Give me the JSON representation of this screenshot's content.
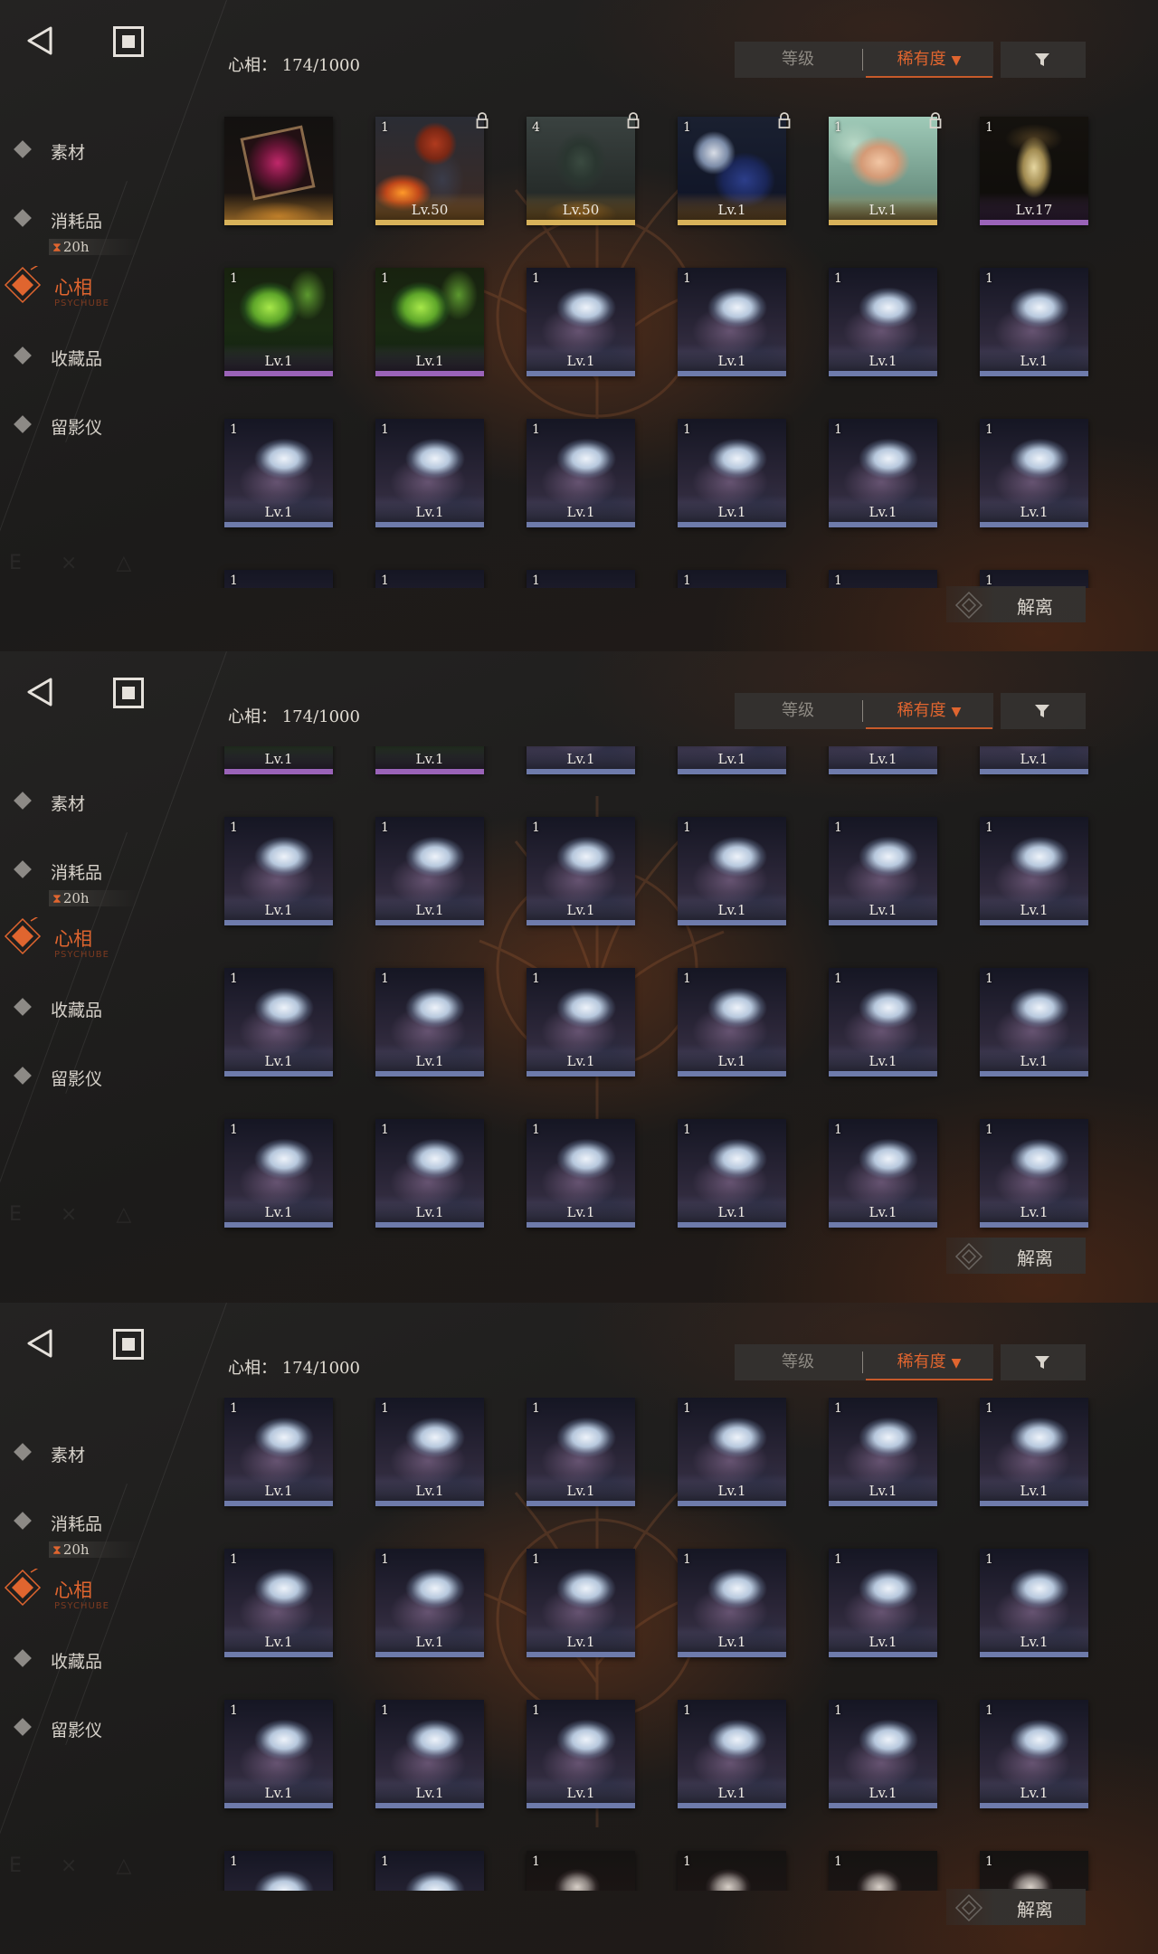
{
  "app": {
    "count_label": "心相：",
    "count_value": "174/1000"
  },
  "nav": {
    "back_icon": "back-triangle-icon",
    "home_icon": "square-home-icon",
    "items": [
      {
        "key": "materials",
        "label": "素材"
      },
      {
        "key": "consumables",
        "label": "消耗品"
      },
      {
        "key": "psychube",
        "label": "心相",
        "sub": "PSYCHUBE",
        "active": true
      },
      {
        "key": "collectibles",
        "label": "收藏品"
      },
      {
        "key": "recorder",
        "label": "留影仪"
      }
    ],
    "timer": "20h"
  },
  "sort": {
    "level_label": "等级",
    "rarity_label": "稀有度",
    "rarity_arrow": "▼",
    "filter_icon": "funnel-filter-icon"
  },
  "actions": {
    "dissolve_label": "解离"
  },
  "colors": {
    "accent": "#e0652f",
    "rarity_gold": "#d8b25a",
    "rarity_purple": "#9a63b8",
    "rarity_blue": "#6e7bab"
  },
  "screens": [
    {
      "rows": [
        [
          {
            "art": "frame",
            "count": "",
            "level": "",
            "rarity": "gold",
            "locked": false
          },
          {
            "art": "redhair",
            "count": "1",
            "level": "Lv.50",
            "rarity": "gold",
            "locked": true
          },
          {
            "art": "cat",
            "count": "4",
            "level": "Lv.50",
            "rarity": "gold",
            "locked": true
          },
          {
            "art": "blue",
            "count": "1",
            "level": "Lv.1",
            "rarity": "gold",
            "locked": true
          },
          {
            "art": "teal",
            "count": "1",
            "level": "Lv.1",
            "rarity": "gold",
            "locked": true
          },
          {
            "art": "gold",
            "count": "1",
            "level": "Lv.17",
            "rarity": "purple",
            "locked": false
          }
        ],
        [
          {
            "art": "green",
            "count": "1",
            "level": "Lv.1",
            "rarity": "purple",
            "locked": false
          },
          {
            "art": "green",
            "count": "1",
            "level": "Lv.1",
            "rarity": "purple",
            "locked": false
          },
          {
            "art": "lily",
            "count": "1",
            "level": "Lv.1",
            "rarity": "blue",
            "locked": false
          },
          {
            "art": "lily",
            "count": "1",
            "level": "Lv.1",
            "rarity": "blue",
            "locked": false
          },
          {
            "art": "lily",
            "count": "1",
            "level": "Lv.1",
            "rarity": "blue",
            "locked": false
          },
          {
            "art": "lily",
            "count": "1",
            "level": "Lv.1",
            "rarity": "blue",
            "locked": false
          }
        ],
        [
          {
            "art": "lily",
            "count": "1",
            "level": "Lv.1",
            "rarity": "blue",
            "locked": false
          },
          {
            "art": "lily",
            "count": "1",
            "level": "Lv.1",
            "rarity": "blue",
            "locked": false
          },
          {
            "art": "lily",
            "count": "1",
            "level": "Lv.1",
            "rarity": "blue",
            "locked": false
          },
          {
            "art": "lily",
            "count": "1",
            "level": "Lv.1",
            "rarity": "blue",
            "locked": false
          },
          {
            "art": "lily",
            "count": "1",
            "level": "Lv.1",
            "rarity": "blue",
            "locked": false
          },
          {
            "art": "lily",
            "count": "1",
            "level": "Lv.1",
            "rarity": "blue",
            "locked": false
          }
        ],
        [
          {
            "art": "lily",
            "count": "1",
            "level": "",
            "rarity": "blue",
            "locked": false
          },
          {
            "art": "lily",
            "count": "1",
            "level": "",
            "rarity": "blue",
            "locked": false
          },
          {
            "art": "lily",
            "count": "1",
            "level": "",
            "rarity": "blue",
            "locked": false
          },
          {
            "art": "lily",
            "count": "1",
            "level": "",
            "rarity": "blue",
            "locked": false
          },
          {
            "art": "lily",
            "count": "1",
            "level": "",
            "rarity": "blue",
            "locked": false
          },
          {
            "art": "lily",
            "count": "1",
            "level": "",
            "rarity": "blue",
            "locked": false
          }
        ]
      ]
    },
    {
      "rows": [
        [
          {
            "art": "green",
            "count": "",
            "level": "Lv.1",
            "rarity": "purple",
            "locked": false
          },
          {
            "art": "green",
            "count": "",
            "level": "Lv.1",
            "rarity": "purple",
            "locked": false
          },
          {
            "art": "lily",
            "count": "",
            "level": "Lv.1",
            "rarity": "blue",
            "locked": false
          },
          {
            "art": "lily",
            "count": "",
            "level": "Lv.1",
            "rarity": "blue",
            "locked": false
          },
          {
            "art": "lily",
            "count": "",
            "level": "Lv.1",
            "rarity": "blue",
            "locked": false
          },
          {
            "art": "lily",
            "count": "",
            "level": "Lv.1",
            "rarity": "blue",
            "locked": false
          }
        ],
        [
          {
            "art": "lily",
            "count": "1",
            "level": "Lv.1",
            "rarity": "blue",
            "locked": false
          },
          {
            "art": "lily",
            "count": "1",
            "level": "Lv.1",
            "rarity": "blue",
            "locked": false
          },
          {
            "art": "lily",
            "count": "1",
            "level": "Lv.1",
            "rarity": "blue",
            "locked": false
          },
          {
            "art": "lily",
            "count": "1",
            "level": "Lv.1",
            "rarity": "blue",
            "locked": false
          },
          {
            "art": "lily",
            "count": "1",
            "level": "Lv.1",
            "rarity": "blue",
            "locked": false
          },
          {
            "art": "lily",
            "count": "1",
            "level": "Lv.1",
            "rarity": "blue",
            "locked": false
          }
        ],
        [
          {
            "art": "lily",
            "count": "1",
            "level": "Lv.1",
            "rarity": "blue",
            "locked": false
          },
          {
            "art": "lily",
            "count": "1",
            "level": "Lv.1",
            "rarity": "blue",
            "locked": false
          },
          {
            "art": "lily",
            "count": "1",
            "level": "Lv.1",
            "rarity": "blue",
            "locked": false
          },
          {
            "art": "lily",
            "count": "1",
            "level": "Lv.1",
            "rarity": "blue",
            "locked": false
          },
          {
            "art": "lily",
            "count": "1",
            "level": "Lv.1",
            "rarity": "blue",
            "locked": false
          },
          {
            "art": "lily",
            "count": "1",
            "level": "Lv.1",
            "rarity": "blue",
            "locked": false
          }
        ],
        [
          {
            "art": "lily",
            "count": "1",
            "level": "Lv.1",
            "rarity": "blue",
            "locked": false
          },
          {
            "art": "lily",
            "count": "1",
            "level": "Lv.1",
            "rarity": "blue",
            "locked": false
          },
          {
            "art": "lily",
            "count": "1",
            "level": "Lv.1",
            "rarity": "blue",
            "locked": false
          },
          {
            "art": "lily",
            "count": "1",
            "level": "Lv.1",
            "rarity": "blue",
            "locked": false
          },
          {
            "art": "lily",
            "count": "1",
            "level": "Lv.1",
            "rarity": "blue",
            "locked": false
          },
          {
            "art": "lily",
            "count": "1",
            "level": "Lv.1",
            "rarity": "blue",
            "locked": false
          }
        ]
      ]
    },
    {
      "rows": [
        [
          {
            "art": "lily",
            "count": "1",
            "level": "Lv.1",
            "rarity": "blue",
            "locked": false
          },
          {
            "art": "lily",
            "count": "1",
            "level": "Lv.1",
            "rarity": "blue",
            "locked": false
          },
          {
            "art": "lily",
            "count": "1",
            "level": "Lv.1",
            "rarity": "blue",
            "locked": false
          },
          {
            "art": "lily",
            "count": "1",
            "level": "Lv.1",
            "rarity": "blue",
            "locked": false
          },
          {
            "art": "lily",
            "count": "1",
            "level": "Lv.1",
            "rarity": "blue",
            "locked": false
          },
          {
            "art": "lily",
            "count": "1",
            "level": "Lv.1",
            "rarity": "blue",
            "locked": false
          }
        ],
        [
          {
            "art": "lily",
            "count": "1",
            "level": "Lv.1",
            "rarity": "blue",
            "locked": false
          },
          {
            "art": "lily",
            "count": "1",
            "level": "Lv.1",
            "rarity": "blue",
            "locked": false
          },
          {
            "art": "lily",
            "count": "1",
            "level": "Lv.1",
            "rarity": "blue",
            "locked": false
          },
          {
            "art": "lily",
            "count": "1",
            "level": "Lv.1",
            "rarity": "blue",
            "locked": false
          },
          {
            "art": "lily",
            "count": "1",
            "level": "Lv.1",
            "rarity": "blue",
            "locked": false
          },
          {
            "art": "lily",
            "count": "1",
            "level": "Lv.1",
            "rarity": "blue",
            "locked": false
          }
        ],
        [
          {
            "art": "lily",
            "count": "1",
            "level": "Lv.1",
            "rarity": "blue",
            "locked": false
          },
          {
            "art": "lily",
            "count": "1",
            "level": "Lv.1",
            "rarity": "blue",
            "locked": false
          },
          {
            "art": "lily",
            "count": "1",
            "level": "Lv.1",
            "rarity": "blue",
            "locked": false
          },
          {
            "art": "lily",
            "count": "1",
            "level": "Lv.1",
            "rarity": "blue",
            "locked": false
          },
          {
            "art": "lily",
            "count": "1",
            "level": "Lv.1",
            "rarity": "blue",
            "locked": false
          },
          {
            "art": "lily",
            "count": "1",
            "level": "Lv.1",
            "rarity": "blue",
            "locked": false
          }
        ],
        [
          {
            "art": "lily",
            "count": "1",
            "level": "",
            "rarity": "blue",
            "locked": false
          },
          {
            "art": "lily",
            "count": "1",
            "level": "",
            "rarity": "blue",
            "locked": false
          },
          {
            "art": "red",
            "count": "1",
            "level": "",
            "rarity": "blue",
            "locked": false
          },
          {
            "art": "red",
            "count": "1",
            "level": "",
            "rarity": "blue",
            "locked": false
          },
          {
            "art": "red",
            "count": "1",
            "level": "",
            "rarity": "blue",
            "locked": false
          },
          {
            "art": "red",
            "count": "1",
            "level": "",
            "rarity": "blue",
            "locked": false
          }
        ]
      ]
    }
  ]
}
